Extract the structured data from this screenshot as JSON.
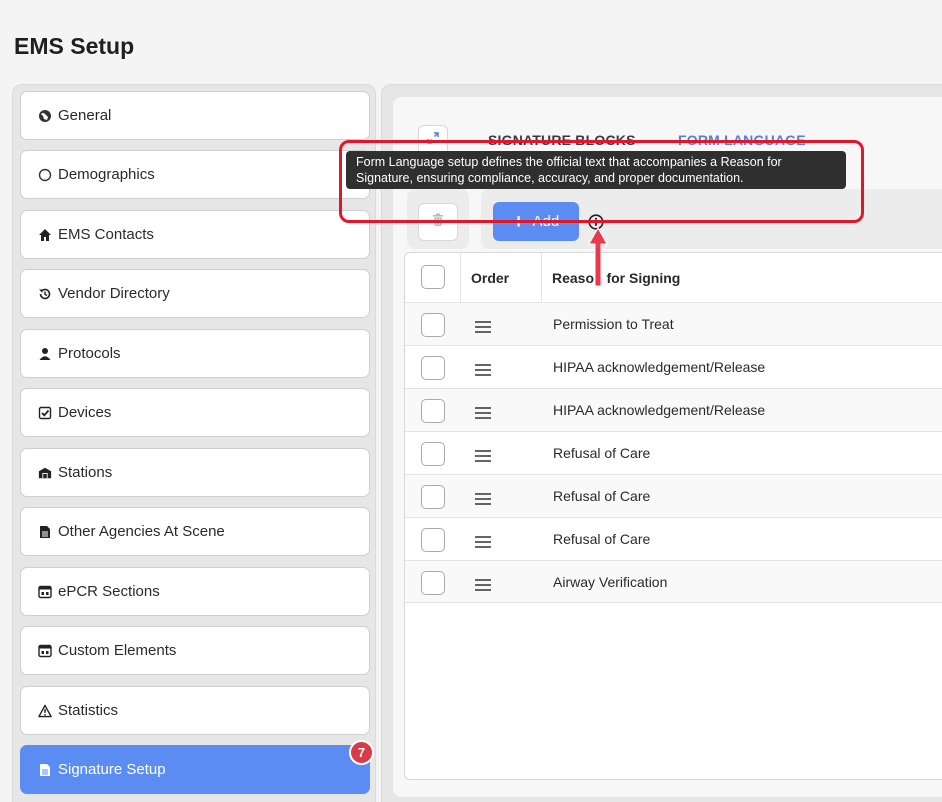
{
  "page": {
    "title": "EMS Setup"
  },
  "sidebar": {
    "items": [
      {
        "label": "General",
        "icon": "globe-icon"
      },
      {
        "label": "Demographics",
        "icon": "circle-icon"
      },
      {
        "label": "EMS Contacts",
        "icon": "home-icon"
      },
      {
        "label": "Vendor Directory",
        "icon": "history-icon"
      },
      {
        "label": "Protocols",
        "icon": "user-icon"
      },
      {
        "label": "Devices",
        "icon": "checkbox-icon"
      },
      {
        "label": "Stations",
        "icon": "station-icon"
      },
      {
        "label": "Other Agencies At Scene",
        "icon": "document-icon"
      },
      {
        "label": "ePCR Sections",
        "icon": "window-icon"
      },
      {
        "label": "Custom Elements",
        "icon": "window-icon"
      },
      {
        "label": "Statistics",
        "icon": "warning-icon"
      },
      {
        "label": "Signature Setup",
        "icon": "document-icon",
        "active": true,
        "badge": "7"
      }
    ]
  },
  "tabs": {
    "signature_blocks": "SIGNATURE BLOCKS",
    "form_language": "FORM LANGUAGE",
    "active": "form_language"
  },
  "toolbar": {
    "add_label": "Add"
  },
  "tooltip": {
    "text": "Form Language setup defines the official text that accompanies a Reason for Signature, ensuring compliance, accuracy, and proper documentation."
  },
  "table": {
    "headers": {
      "order": "Order",
      "reason": "Reason for Signing"
    },
    "rows": [
      "Permission to Treat",
      "HIPAA acknowledgement/Release",
      "HIPAA acknowledgement/Release",
      "Refusal of Care",
      "Refusal of Care",
      "Refusal of Care",
      "Airway Verification"
    ]
  },
  "colors": {
    "accent": "#5b8cf2",
    "badge": "#d93a46",
    "highlight": "#e2162a",
    "tab_active": "#4a7fe6"
  }
}
